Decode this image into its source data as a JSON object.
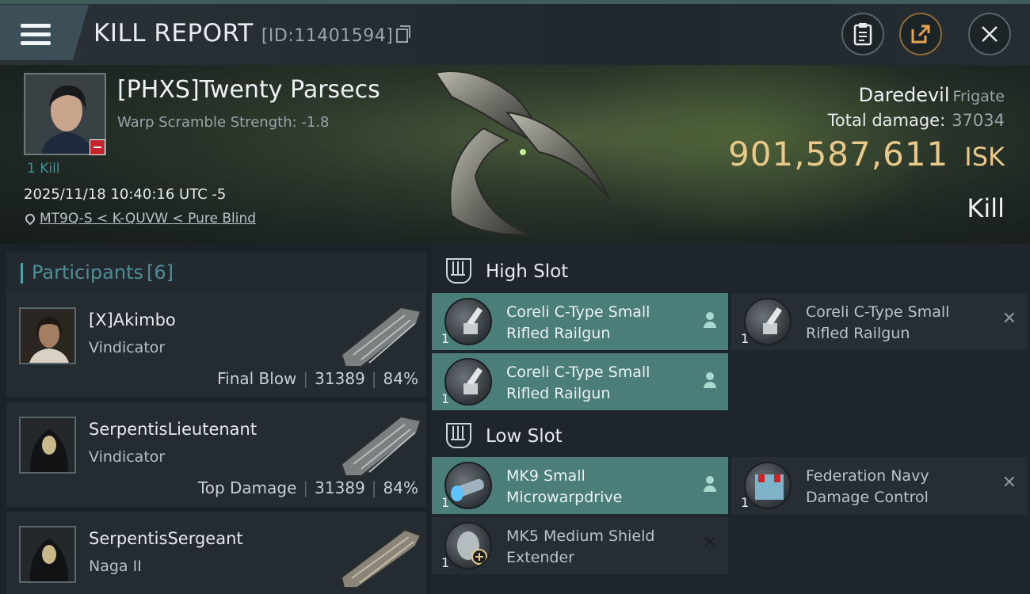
{
  "header": {
    "title": "KILL REPORT",
    "id_text": "[ID:11401594]",
    "buttons": [
      "clipboard-icon",
      "share-icon",
      "close-icon"
    ]
  },
  "victim": {
    "name": "[PHXS]Twenty Parsecs",
    "scram": "Warp Scramble Strength: -1.8",
    "kills": "1 Kill",
    "timestamp": "2025/11/18 10:40:16 UTC -5",
    "location": "MT9Q-S < K-QUVW < Pure Blind",
    "ship": "Daredevil",
    "ship_class": "Frigate",
    "total_damage_label": "Total damage:",
    "total_damage": "37034",
    "isk_value": "901,587,611",
    "isk_unit": "ISK",
    "result": "Kill"
  },
  "participants": {
    "label": "Participants",
    "count": "[6]",
    "rows": [
      {
        "name": "[X]Akimbo",
        "ship": "Vindicator",
        "tag": "Final Blow",
        "damage": "31389",
        "percent": "84%"
      },
      {
        "name": "SerpentisLieutenant",
        "ship": "Vindicator",
        "tag": "Top Damage",
        "damage": "31389",
        "percent": "84%"
      },
      {
        "name": "SerpentisSergeant",
        "ship": "Naga II",
        "tag": "",
        "damage": "",
        "percent": ""
      }
    ]
  },
  "fitting": {
    "high_slot": {
      "title": "High Slot",
      "modules": [
        {
          "name": "Coreli C-Type Small Rifled Railgun",
          "qty": "1",
          "state": "fitted"
        },
        {
          "name": "Coreli C-Type Small Rifled Railgun",
          "qty": "1",
          "state": "destroyed"
        },
        {
          "name": "Coreli C-Type Small Rifled Railgun",
          "qty": "1",
          "state": "fitted"
        }
      ]
    },
    "low_slot": {
      "title": "Low Slot",
      "modules": [
        {
          "name": "MK9 Small Microwarpdrive",
          "qty": "1",
          "state": "fitted"
        },
        {
          "name": "Federation Navy Damage Control",
          "qty": "1",
          "state": "destroyed"
        },
        {
          "name": "MK5 Medium Shield Extender",
          "qty": "1",
          "state": "destroyed"
        }
      ]
    }
  },
  "colors": {
    "accent_teal": "#4b7e79",
    "isk_gold": "#e8c98a",
    "loss_red": "#c4262b"
  }
}
